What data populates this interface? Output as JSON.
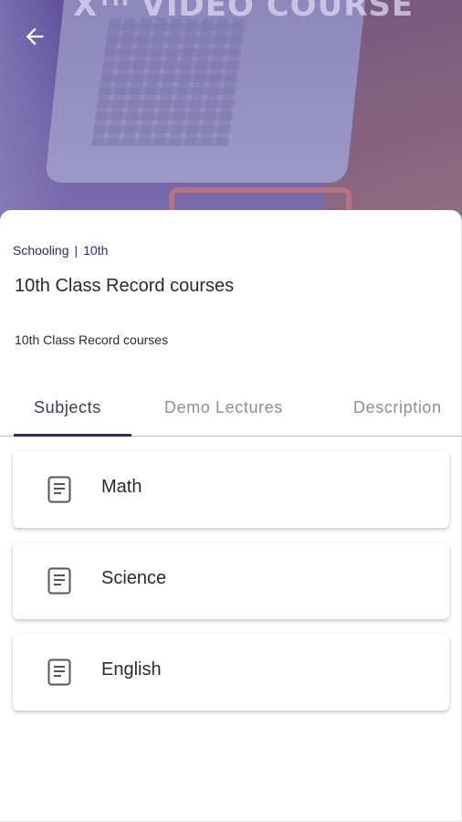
{
  "hero": {
    "title": "Xᵀᴴ VIDEO COURSE"
  },
  "nav": {
    "back_icon": "arrow-left-icon"
  },
  "course": {
    "category": "Schooling",
    "separator": "|",
    "grade": "10th",
    "title": "10th Class Record courses",
    "subtitle": "10th Class Record courses"
  },
  "tabs": [
    {
      "label": "Subjects",
      "active": true
    },
    {
      "label": "Demo Lectures",
      "active": false
    },
    {
      "label": "Description",
      "active": false
    }
  ],
  "subjects": [
    {
      "label": "Math",
      "icon": "document-icon"
    },
    {
      "label": "Science",
      "icon": "document-icon"
    },
    {
      "label": "English",
      "icon": "document-icon"
    }
  ],
  "colors": {
    "accent": "#2d2a6e",
    "hero_overlay": "#5b4c97",
    "text": "#2b2b2b",
    "muted": "#8f8f8f"
  }
}
